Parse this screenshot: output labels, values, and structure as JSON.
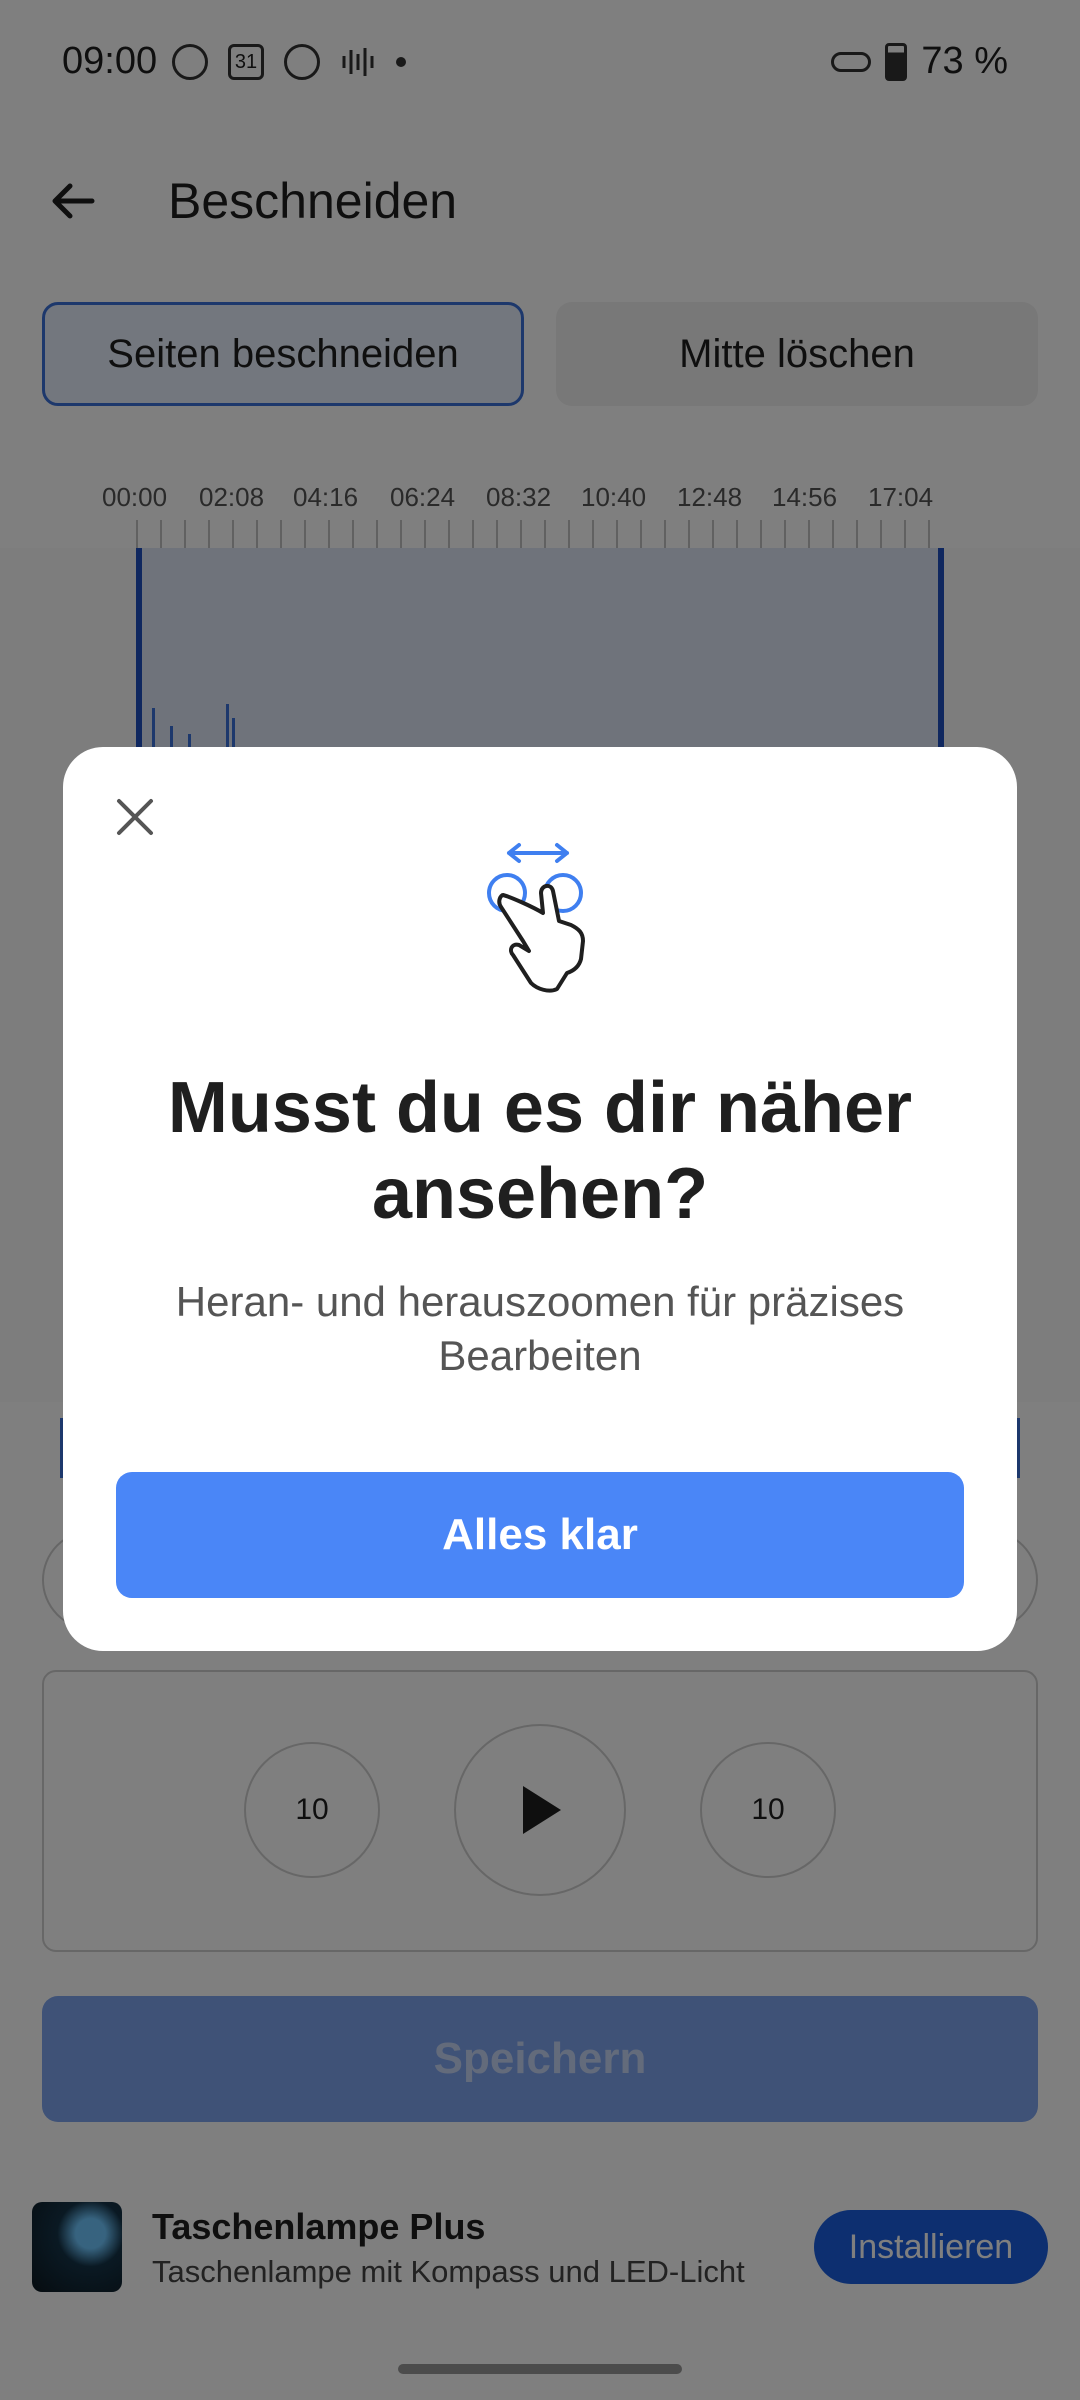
{
  "status_bar": {
    "time": "09:00",
    "calendar_day": "31",
    "battery": "73 %"
  },
  "header": {
    "title": "Beschneiden"
  },
  "tabs": [
    {
      "label": "Seiten beschneiden",
      "selected": true
    },
    {
      "label": "Mitte löschen",
      "selected": false
    }
  ],
  "timeline": {
    "labels": [
      "00:00",
      "02:08",
      "04:16",
      "06:24",
      "08:32",
      "10:40",
      "12:48",
      "14:56",
      "17:04"
    ]
  },
  "player": {
    "rewind_label": "10",
    "forward_label": "10"
  },
  "save_button": "Speichern",
  "ad": {
    "title": "Taschenlampe Plus",
    "subtitle": "Taschenlampe mit Kompass und LED-Licht",
    "install_label": "Installieren"
  },
  "dialog": {
    "title": "Musst du es dir näher ansehen?",
    "subtitle": "Heran- und herauszoomen für präzises Bearbeiten",
    "button_label": "Alles klar",
    "icon": "pinch-zoom-hand-icon"
  },
  "colors": {
    "accent": "#4a86f7",
    "install": "#1a5fe0"
  }
}
